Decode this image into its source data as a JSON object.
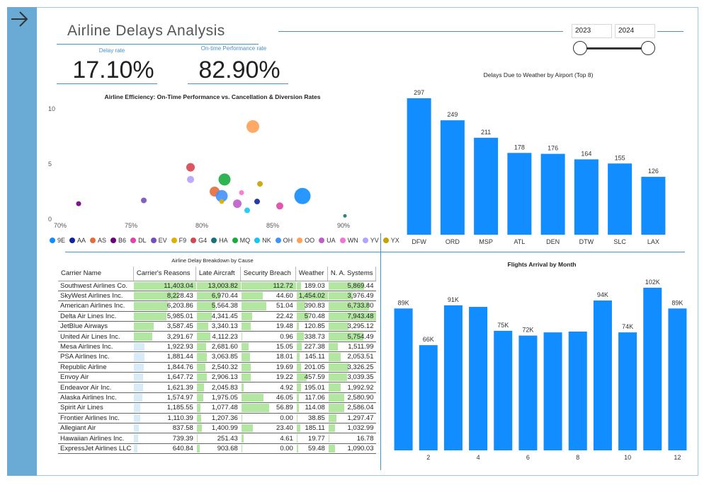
{
  "header": {
    "title": "Airline Delays Analysis"
  },
  "year_filter": {
    "start": "2023",
    "end": "2024"
  },
  "kpis": {
    "delay_rate": {
      "label": "Delay rate",
      "value": "17.10%"
    },
    "ontime_rate": {
      "label": "On-time Performance rate",
      "value": "82.90%"
    }
  },
  "scatter": {
    "title": "Airline Efficiency: On-Time Performance vs. Cancellation & Diversion Rates",
    "y_ticks": [
      "10",
      "5",
      "0"
    ],
    "x_ticks": [
      "70%",
      "75%",
      "80%",
      "85%",
      "90%"
    ],
    "legend": [
      {
        "code": "9E",
        "color": "#118dff"
      },
      {
        "code": "AA",
        "color": "#12239e"
      },
      {
        "code": "AS",
        "color": "#e66c37"
      },
      {
        "code": "B6",
        "color": "#6b007b"
      },
      {
        "code": "DL",
        "color": "#e044a7"
      },
      {
        "code": "EV",
        "color": "#744ec2"
      },
      {
        "code": "F9",
        "color": "#d9b300"
      },
      {
        "code": "G4",
        "color": "#d64550"
      },
      {
        "code": "HA",
        "color": "#197278"
      },
      {
        "code": "MQ",
        "color": "#1aab40"
      },
      {
        "code": "NK",
        "color": "#15c6f4"
      },
      {
        "code": "OH",
        "color": "#4092ff"
      },
      {
        "code": "OO",
        "color": "#ffa058"
      },
      {
        "code": "UA",
        "color": "#be5dc9"
      },
      {
        "code": "WN",
        "color": "#f472d0"
      },
      {
        "code": "YV",
        "color": "#b5a1ff"
      },
      {
        "code": "YX",
        "color": "#c4a200"
      }
    ]
  },
  "table": {
    "title": "Airline Delay Breakdown by Cause",
    "columns": [
      "Carrier Name",
      "Carrier's Reasons",
      "Late Aircraft",
      "Security Breach",
      "Weather",
      "N. A. Systems"
    ],
    "rows": [
      [
        "Southwest Airlines Co.",
        "11,403.04",
        "13,003.82",
        "112.72",
        "189.03",
        "5,869.44"
      ],
      [
        "SkyWest Airlines Inc.",
        "8,228.43",
        "6,970.44",
        "44.60",
        "1,454.02",
        "3,976.49"
      ],
      [
        "American Airlines Inc.",
        "6,203.86",
        "5,564.38",
        "51.04",
        "390.83",
        "6,733.80"
      ],
      [
        "Delta Air Lines Inc.",
        "5,985.01",
        "4,341.45",
        "22.42",
        "570.48",
        "7,943.48"
      ],
      [
        "JetBlue Airways",
        "3,587.45",
        "3,340.13",
        "19.48",
        "120.85",
        "3,295.12"
      ],
      [
        "United Air Lines Inc.",
        "3,291.67",
        "4,112.23",
        "0.96",
        "338.73",
        "5,754.49"
      ],
      [
        "Mesa Airlines Inc.",
        "1,922.93",
        "2,681.60",
        "15.05",
        "227.38",
        "1,511.99"
      ],
      [
        "PSA Airlines Inc.",
        "1,881.44",
        "3,063.85",
        "18.01",
        "145.11",
        "2,053.51"
      ],
      [
        "Republic Airline",
        "1,844.76",
        "2,540.32",
        "19.69",
        "201.05",
        "3,326.25"
      ],
      [
        "Envoy Air",
        "1,647.72",
        "2,906.13",
        "19.22",
        "457.59",
        "3,039.35"
      ],
      [
        "Endeavor Air Inc.",
        "1,621.39",
        "2,045.83",
        "4.92",
        "195.01",
        "1,992.92"
      ],
      [
        "Alaska Airlines Inc.",
        "1,574.97",
        "1,975.05",
        "46.05",
        "117.06",
        "2,580.90"
      ],
      [
        "Spirit Air Lines",
        "1,185.55",
        "1,077.48",
        "56.89",
        "114.08",
        "2,586.04"
      ],
      [
        "Frontier Airlines Inc.",
        "1,110.39",
        "1,207.36",
        "0.00",
        "38.85",
        "1,297.47"
      ],
      [
        "Allegiant Air",
        "837.58",
        "1,400.99",
        "23.40",
        "185.11",
        "1,032.99"
      ],
      [
        "Hawaiian Airlines Inc.",
        "739.39",
        "251.43",
        "4.61",
        "19.77",
        "16.78"
      ],
      [
        "ExpressJet Airlines LLC",
        "640.84",
        "903.68",
        "0.00",
        "59.48",
        "1,090.03"
      ]
    ]
  },
  "chart_data": [
    {
      "type": "scatter",
      "title": "Airline Efficiency: On-Time Performance vs. Cancellation & Diversion Rates",
      "xlim": [
        70,
        91
      ],
      "ylim": [
        0,
        10
      ],
      "points": [
        {
          "x": 71.3,
          "y": 1.4,
          "r": 3.5,
          "c": "#6b007b"
        },
        {
          "x": 75.9,
          "y": 1.7,
          "r": 4,
          "c": "#744ec2"
        },
        {
          "x": 79.2,
          "y": 4.7,
          "r": 6,
          "c": "#d64550"
        },
        {
          "x": 79.2,
          "y": 3.6,
          "r": 5,
          "c": "#b5a1ff"
        },
        {
          "x": 80.9,
          "y": 2.5,
          "r": 7,
          "c": "#e66c37"
        },
        {
          "x": 81.4,
          "y": 2.1,
          "r": 8.5,
          "c": "#4092ff"
        },
        {
          "x": 81.4,
          "y": 1.6,
          "r": 3.5,
          "c": "#d9b300"
        },
        {
          "x": 81.6,
          "y": 3.6,
          "r": 8.5,
          "c": "#1aab40"
        },
        {
          "x": 82.5,
          "y": 1.4,
          "r": 6,
          "c": "#be5dc9"
        },
        {
          "x": 82.8,
          "y": 2.4,
          "r": 3.5,
          "c": "#f472d0"
        },
        {
          "x": 83.2,
          "y": 0.8,
          "r": 4,
          "c": "#15c6f4"
        },
        {
          "x": 83.6,
          "y": 8.4,
          "r": 9,
          "c": "#ffa058"
        },
        {
          "x": 83.9,
          "y": 1.6,
          "r": 4,
          "c": "#12239e"
        },
        {
          "x": 84.1,
          "y": 3.2,
          "r": 4,
          "c": "#c4a200"
        },
        {
          "x": 85.5,
          "y": 1.2,
          "r": 5,
          "c": "#e044a7"
        },
        {
          "x": 87.1,
          "y": 2.1,
          "r": 11.5,
          "c": "#118dff"
        },
        {
          "x": 90.1,
          "y": 0.3,
          "r": 2.5,
          "c": "#197278"
        }
      ]
    },
    {
      "type": "bar",
      "title": "Delays Due to Weather by Airport (Top 8)",
      "categories": [
        "DFW",
        "ORD",
        "MSP",
        "ATL",
        "DEN",
        "DTW",
        "SLC",
        "LAX"
      ],
      "values": [
        297,
        249,
        211,
        178,
        176,
        164,
        155,
        126
      ],
      "ylim": [
        0,
        300
      ],
      "color": "#118dff"
    },
    {
      "type": "bar",
      "title": "Flights Arrival by Month",
      "categories": [
        1,
        2,
        3,
        4,
        5,
        6,
        7,
        8,
        9,
        10,
        11,
        12
      ],
      "x_tick_labels": [
        "",
        "2",
        "",
        "4",
        "",
        "6",
        "",
        "8",
        "",
        "10",
        "",
        "12"
      ],
      "values": [
        89,
        66,
        91,
        90,
        75,
        72,
        74,
        74.5,
        94,
        74,
        102,
        89
      ],
      "data_labels": [
        "89K",
        "66K",
        "91K",
        "",
        "75K",
        "72K",
        "",
        "",
        "94K",
        "74K",
        "102K",
        "89K"
      ],
      "ylim": [
        0,
        102
      ],
      "color": "#118dff"
    }
  ]
}
